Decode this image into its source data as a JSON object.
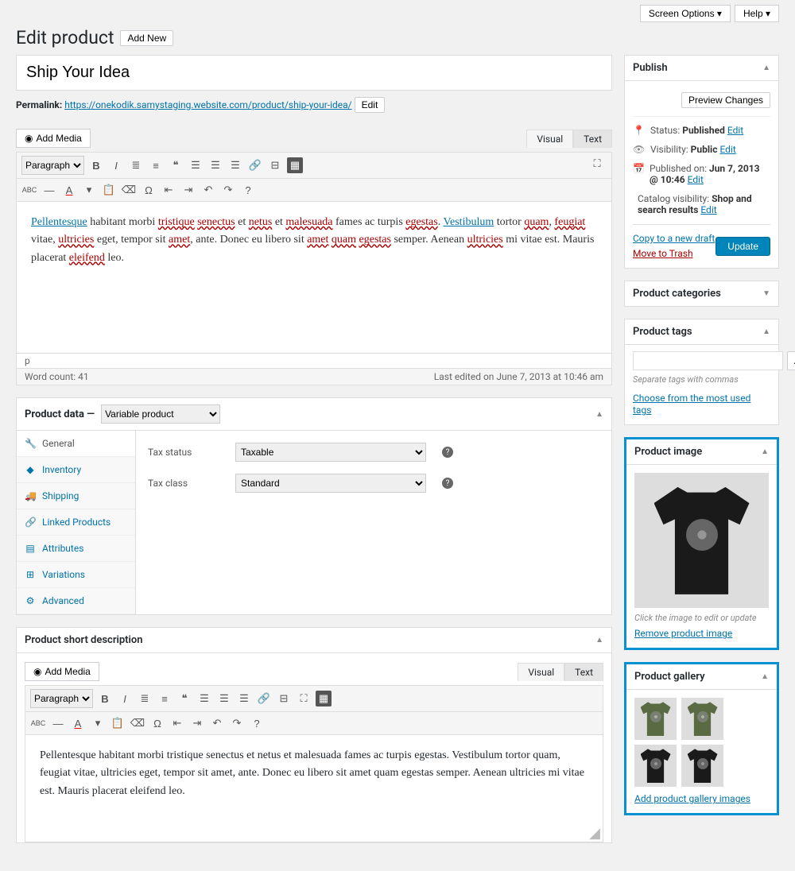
{
  "topbar": {
    "screen_options": "Screen Options ▾",
    "help": "Help ▾"
  },
  "header": {
    "page_title": "Edit product",
    "add_new": "Add New"
  },
  "title": {
    "value": "Ship Your Idea"
  },
  "permalink": {
    "label": "Permalink:",
    "url": "https://onekodik.samystaging.website.com/product/ship-your-idea/",
    "edit": "Edit"
  },
  "editor": {
    "add_media": "Add Media",
    "visual": "Visual",
    "text": "Text",
    "format": "Paragraph",
    "body": "Pellentesque habitant morbi tristique senectus et netus et malesuada fames ac turpis egestas. Vestibulum tortor quam, feugiat vitae, ultricies eget, tempor sit amet, ante. Donec eu libero sit amet quam egestas semper. Aenean ultricies mi vitae est. Mauris placerat eleifend leo.",
    "path_indicator": "p",
    "word_count": "Word count: 41",
    "last_edited": "Last edited on June 7, 2013 at 10:46 am"
  },
  "product_data": {
    "heading": "Product data —",
    "type": "Variable product",
    "tabs": [
      "General",
      "Inventory",
      "Shipping",
      "Linked Products",
      "Attributes",
      "Variations",
      "Advanced"
    ],
    "tax_status_label": "Tax status",
    "tax_status_value": "Taxable",
    "tax_class_label": "Tax class",
    "tax_class_value": "Standard"
  },
  "short_desc": {
    "title": "Product short description",
    "add_media": "Add Media",
    "format": "Paragraph",
    "body": "Pellentesque habitant morbi tristique senectus et netus et malesuada fames ac turpis egestas. Vestibulum tortor quam, feugiat vitae, ultricies eget, tempor sit amet, ante. Donec eu libero sit amet quam egestas semper. Aenean ultricies mi vitae est. Mauris placerat eleifend leo."
  },
  "publish": {
    "title": "Publish",
    "preview": "Preview Changes",
    "status_label": "Status:",
    "status_value": "Published",
    "visibility_label": "Visibility:",
    "visibility_value": "Public",
    "published_on_label": "Published on:",
    "published_on_value": "Jun 7, 2013 @ 10:46",
    "catalog_label": "Catalog visibility:",
    "catalog_value": "Shop and search results",
    "edit": "Edit",
    "copy_draft": "Copy to a new draft",
    "trash": "Move to Trash",
    "update": "Update"
  },
  "categories": {
    "title": "Product categories"
  },
  "tags": {
    "title": "Product tags",
    "add": "Add",
    "note": "Separate tags with commas",
    "choose": "Choose from the most used tags"
  },
  "product_image": {
    "title": "Product image",
    "note": "Click the image to edit or update",
    "remove": "Remove product image"
  },
  "gallery": {
    "title": "Product gallery",
    "add": "Add product gallery images"
  }
}
